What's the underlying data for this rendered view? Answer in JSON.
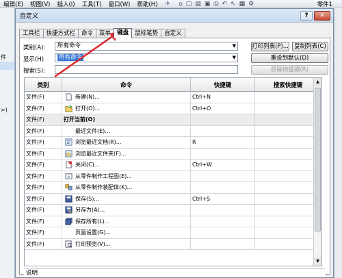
{
  "menubar": {
    "items": [
      "编辑(E)",
      "视图(V)",
      "插入(I)",
      "工具(T)",
      "窗口(W)",
      "帮助(H)"
    ],
    "document_title": "零件1"
  },
  "left_panel": {
    "label1": "件",
    "label2": ">)"
  },
  "dialog": {
    "title": "自定义",
    "help_label": "?",
    "close_label": "✕",
    "tabs": [
      "工具栏",
      "快捷方式栏",
      "命令",
      "菜单",
      "键盘",
      "鼠标笔势",
      "自定义"
    ],
    "active_tab": "键盘"
  },
  "keyboard": {
    "category_label": "类别(A):",
    "category_value": "所有命令",
    "show_label": "显示(H)",
    "show_value": "所有命令",
    "search_label": "搜索(S):",
    "search_value": "",
    "print_button": "打印列表(P)...",
    "copy_button": "复制列表(C)",
    "reset_button": "重设到默认(D)",
    "remove_button": "移除快捷键(R)",
    "columns": [
      "类别",
      "命令",
      "快捷键",
      "搜索快捷键"
    ],
    "rows": [
      {
        "category": "文件(F)",
        "command": "新建(N)...",
        "shortcut": "Ctrl+N",
        "search": "",
        "icon": "new-document-icon",
        "group": false,
        "indent": false
      },
      {
        "category": "文件(F)",
        "command": "打开(O)...",
        "shortcut": "Ctrl+O",
        "search": "",
        "icon": "open-folder-icon",
        "group": false,
        "indent": false
      },
      {
        "category": "文件(F)",
        "command": "打开当前(O)",
        "shortcut": "",
        "search": "",
        "icon": "",
        "group": true,
        "indent": false
      },
      {
        "category": "文件(F)",
        "command": "最近文件(E)...",
        "shortcut": "",
        "search": "",
        "icon": "",
        "group": false,
        "indent": true
      },
      {
        "category": "文件(F)",
        "command": "浏览最近文档(R)...",
        "shortcut": "R",
        "search": "",
        "icon": "browse-recent-docs-icon",
        "group": false,
        "indent": false
      },
      {
        "category": "文件(F)",
        "command": "浏览最近文件夹(F)...",
        "shortcut": "",
        "search": "",
        "icon": "browse-recent-folders-icon",
        "group": false,
        "indent": false
      },
      {
        "category": "文件(F)",
        "command": "关闭(C)...",
        "shortcut": "Ctrl+W",
        "search": "",
        "icon": "close-document-icon",
        "group": false,
        "indent": false
      },
      {
        "category": "文件(F)",
        "command": "从零件制作工程图(E)...",
        "shortcut": "",
        "search": "",
        "icon": "make-drawing-icon",
        "group": false,
        "indent": false
      },
      {
        "category": "文件(F)",
        "command": "从零件制作装配体(K)...",
        "shortcut": "",
        "search": "",
        "icon": "make-assembly-icon",
        "group": false,
        "indent": false
      },
      {
        "category": "文件(F)",
        "command": "保存(S)...",
        "shortcut": "Ctrl+S",
        "search": "",
        "icon": "save-icon",
        "group": false,
        "indent": false
      },
      {
        "category": "文件(F)",
        "command": "另存为(A)...",
        "shortcut": "",
        "search": "",
        "icon": "save-as-icon",
        "group": false,
        "indent": false
      },
      {
        "category": "文件(F)",
        "command": "保存所有(L)...",
        "shortcut": "",
        "search": "",
        "icon": "save-all-icon",
        "group": false,
        "indent": false
      },
      {
        "category": "文件(F)",
        "command": "页面设置(G)...",
        "shortcut": "",
        "search": "",
        "icon": "",
        "group": false,
        "indent": true
      },
      {
        "category": "文件(F)",
        "command": "打印预览(V)...",
        "shortcut": "",
        "search": "",
        "icon": "print-preview-icon",
        "group": false,
        "indent": false
      }
    ],
    "description_label": "说明"
  },
  "colors": {
    "annotation_arrow": "#e0252b",
    "selection": "#3875d7"
  }
}
